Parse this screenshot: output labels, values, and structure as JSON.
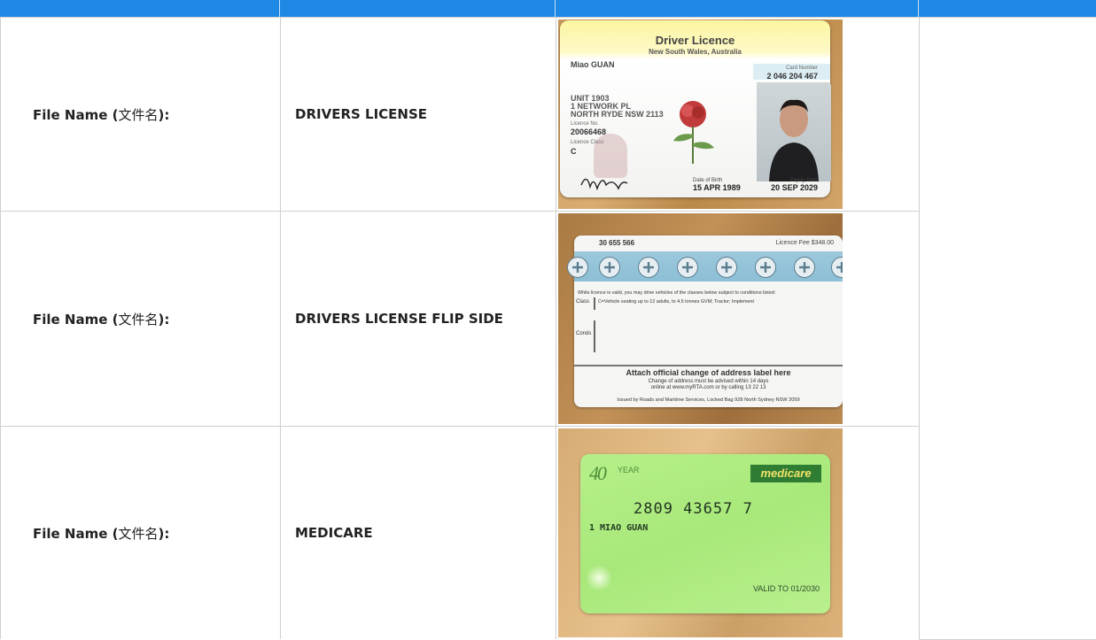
{
  "header": {
    "title": ""
  },
  "rows": [
    {
      "label_prefix": "File Name (",
      "label_cn": "文件名",
      "label_suffix": "):",
      "file_name": "DRIVERS LICENSE",
      "image": {
        "title": "Driver Licence",
        "subtitle": "New South Wales, Australia",
        "name": "Miao GUAN",
        "card_number_label": "Card Number",
        "card_number": "2 046 204 467",
        "address": "UNIT 1903\n1 NETWORK PL\nNORTH RYDE NSW 2113",
        "licence_no_label": "Licence No.",
        "licence_no": "20066468",
        "licence_class_label": "Licence Class",
        "licence_class": "C",
        "dob_label": "Date of Birth",
        "dob": "15 APR 1989",
        "expiry_label": "Expiry Date",
        "expiry": "20 SEP 2029"
      }
    },
    {
      "label_prefix": "File Name (",
      "label_cn": "文件名",
      "label_suffix": "):",
      "file_name": "DRIVERS LICENSE FLIP SIDE",
      "image": {
        "number": "30 655 566",
        "fee": "Licence Fee  $348.00",
        "valid_text": "While licence is valid, you may drive vehicles of the classes below subject to conditions listed:",
        "class_label": "Class",
        "class_text": "C=Vehicle seating up to 12 adults, to 4.5 tonnes GVM; Tractor; Implement",
        "conds_label": "Conds",
        "attach": "Attach official change of address label here",
        "change1": "Change of address must be advised within 14 days",
        "change2": "online at www.myRTA.com or by calling 13 22 13",
        "issued": "Issued by Roads and Maritime Services, Locked Bag 928 North Sydney NSW 2059"
      }
    },
    {
      "label_prefix": "File Name (",
      "label_cn": "文件名",
      "label_suffix": "):",
      "file_name": "MEDICARE",
      "image": {
        "logo": "medicare",
        "forty": "40",
        "year": "YEAR",
        "number": "2809 43657 7",
        "name": "1  MIAO GUAN",
        "valid": "VALID TO 01/2030"
      }
    }
  ],
  "colors": {
    "header": "#1e88e5",
    "border": "#cfcfcf"
  }
}
